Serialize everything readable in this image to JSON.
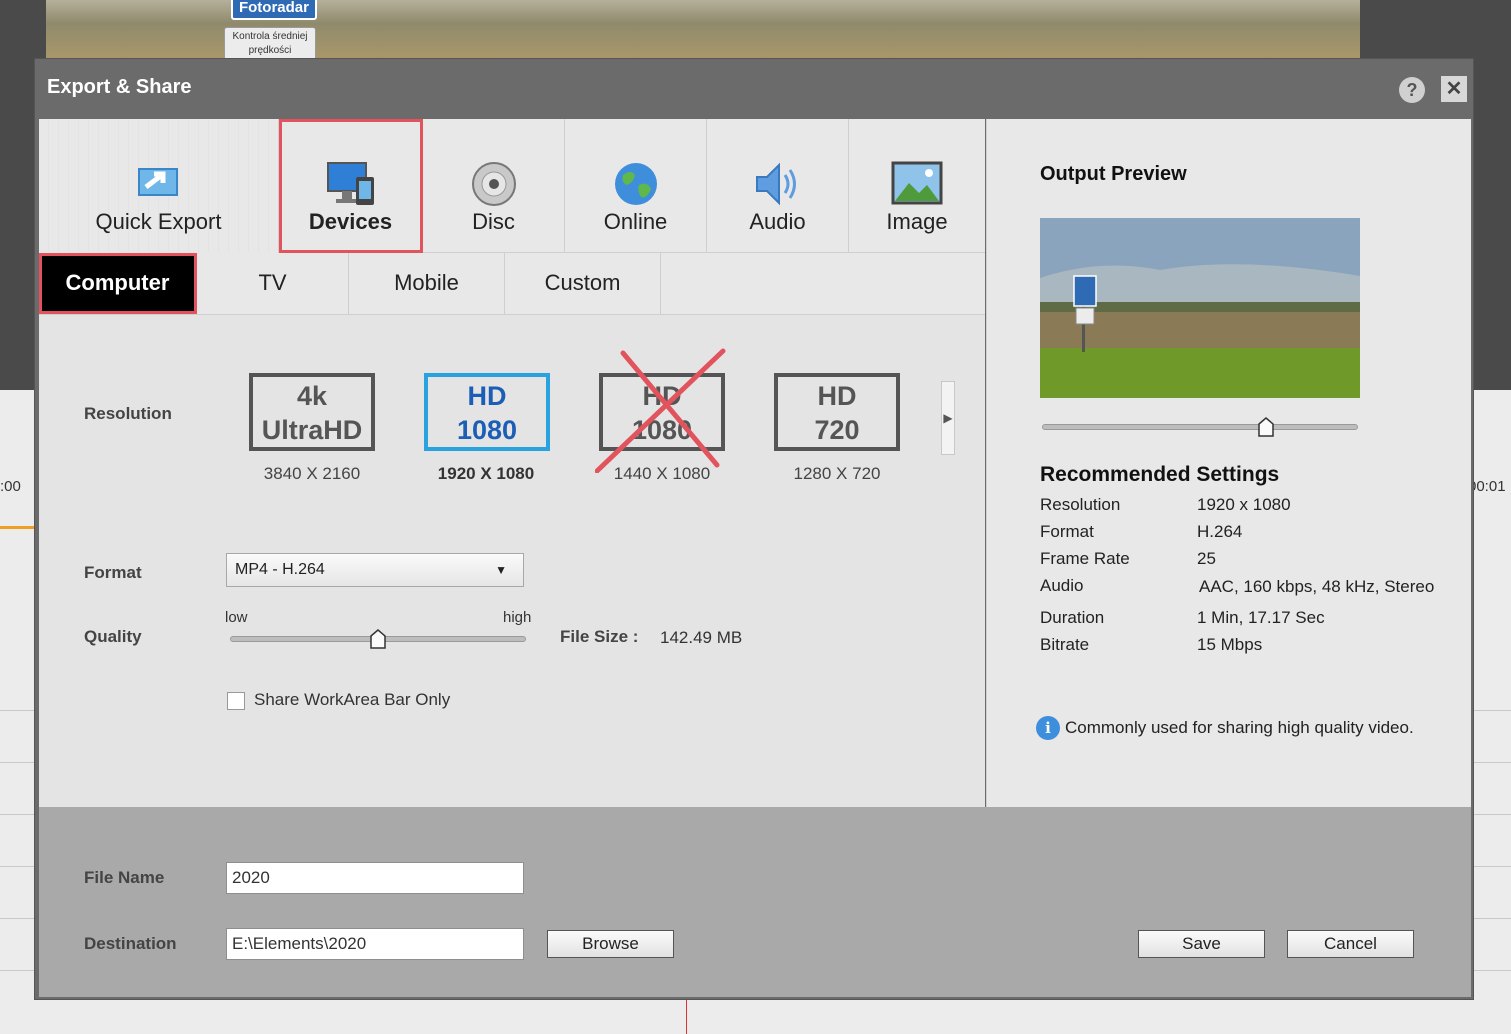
{
  "background": {
    "video_sign": "Fotoradar",
    "video_sign_small": "Kontrola średniej prędkości",
    "timeline_left": ":00",
    "timeline_right": "00:01"
  },
  "dialog": {
    "title": "Export & Share",
    "help_glyph": "?",
    "close_glyph": "✕"
  },
  "tabs": [
    {
      "label": "Quick Export",
      "icon": "export-icon"
    },
    {
      "label": "Devices",
      "icon": "devices-icon"
    },
    {
      "label": "Disc",
      "icon": "disc-icon"
    },
    {
      "label": "Online",
      "icon": "globe-icon"
    },
    {
      "label": "Audio",
      "icon": "speaker-icon"
    },
    {
      "label": "Image",
      "icon": "image-icon"
    }
  ],
  "subtabs": [
    "Computer",
    "TV",
    "Mobile",
    "Custom"
  ],
  "settings": {
    "resolution_label": "Resolution",
    "presets": [
      {
        "line1": "4k",
        "line2": "UltraHD",
        "size": "3840 X 2160"
      },
      {
        "line1": "HD",
        "line2": "1080",
        "size": "1920 X 1080"
      },
      {
        "line1": "HD",
        "line2": "1080",
        "size": "1440 X 1080"
      },
      {
        "line1": "HD",
        "line2": "720",
        "size": "1280 X 720"
      }
    ],
    "selected_preset": 1,
    "format_label": "Format",
    "format_value": "MP4 - H.264",
    "quality_label": "Quality",
    "quality_low": "low",
    "quality_high": "high",
    "quality_level": 0.5,
    "file_size_label": "File Size :",
    "file_size_value": "142.49 MB",
    "workarea_label": "Share WorkArea Bar Only",
    "workarea_checked": false
  },
  "output": {
    "preview_title": "Output Preview",
    "scrub_position": 0.71,
    "recommended_title": "Recommended Settings",
    "rows": [
      {
        "key": "Resolution",
        "value": "1920 x 1080"
      },
      {
        "key": "Format",
        "value": "H.264"
      },
      {
        "key": "Frame Rate",
        "value": "25"
      },
      {
        "key": "Audio",
        "value": "AAC, 160 kbps, 48 kHz, Stereo"
      },
      {
        "key": "Duration",
        "value": "1 Min, 17.17 Sec"
      },
      {
        "key": "Bitrate",
        "value": "15 Mbps"
      }
    ],
    "info_text": "Commonly used for sharing high quality video."
  },
  "footer": {
    "file_name_label": "File Name",
    "file_name_value": "2020",
    "destination_label": "Destination",
    "destination_value": "E:\\Elements\\2020",
    "browse_label": "Browse",
    "save_label": "Save",
    "cancel_label": "Cancel"
  },
  "colors": {
    "highlight": "#e2545d",
    "selected_border": "#29a3e0",
    "selected_text": "#1c5eb5"
  }
}
